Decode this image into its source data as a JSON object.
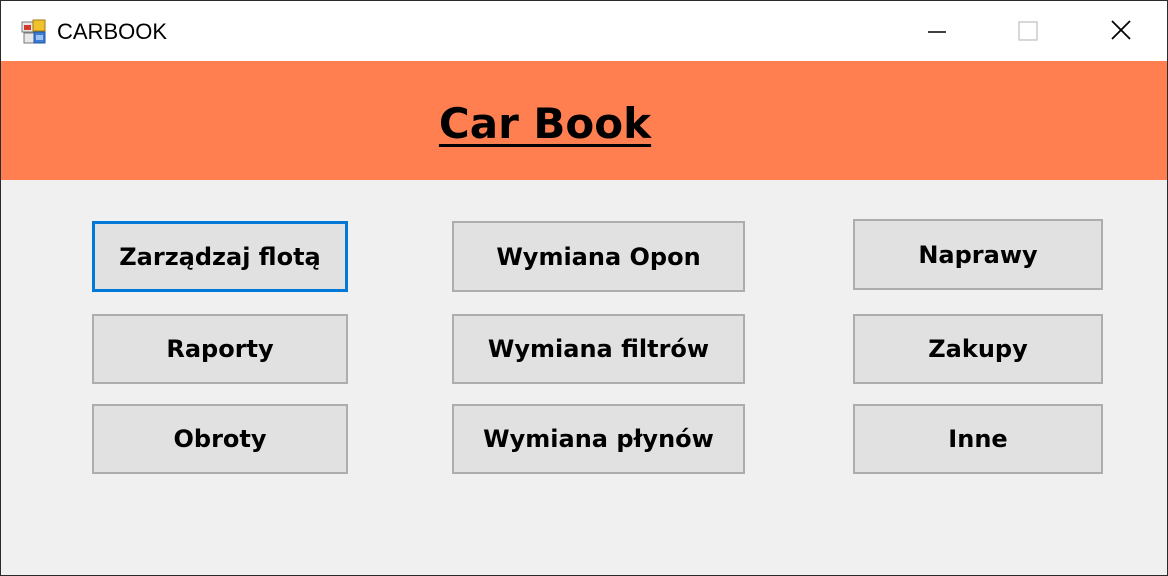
{
  "window": {
    "title": "CARBOOK",
    "app_icon": "windows-forms-app-icon",
    "controls": {
      "minimize_icon": "minimize-icon",
      "maximize_icon": "maximize-icon",
      "close_icon": "close-icon"
    }
  },
  "header": {
    "title": "Car Book",
    "background_color": "#ff7f50"
  },
  "buttons": {
    "manage_fleet": "Zarządzaj flotą",
    "tire_change": "Wymiana Opon",
    "repairs": "Naprawy",
    "reports": "Raporty",
    "filter_change": "Wymiana filtrów",
    "purchases": "Zakupy",
    "turnover": "Obroty",
    "fluid_change": "Wymiana płynów",
    "other": "Inne"
  },
  "colors": {
    "focus_border": "#0078d7",
    "button_face": "#e1e1e1",
    "form_background": "#f0f0f0"
  }
}
